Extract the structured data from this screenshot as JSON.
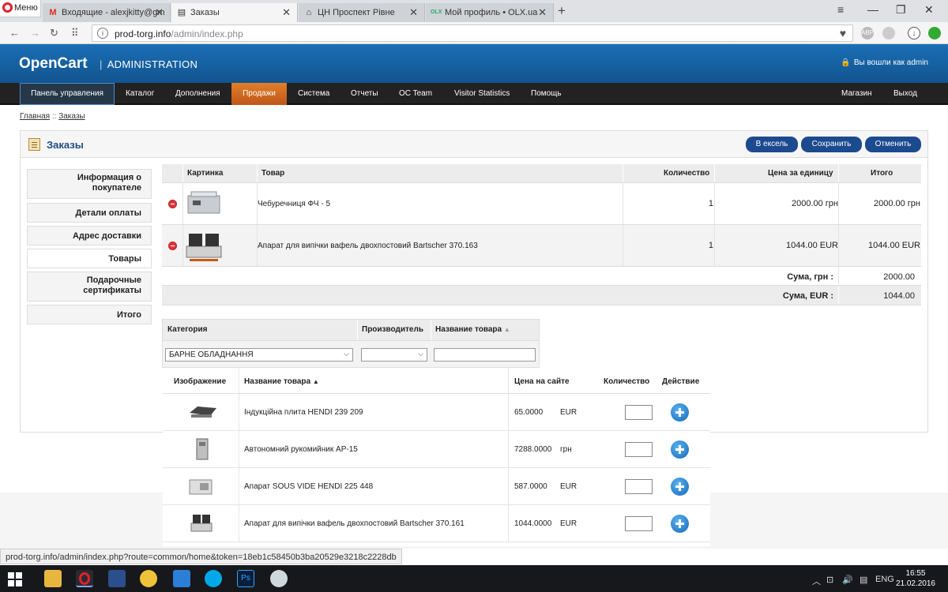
{
  "browser": {
    "menu_label": "Меню",
    "tabs": [
      {
        "icon": "M",
        "title": "Входящие - alexjkitty@gm"
      },
      {
        "icon": "▤",
        "title": "Заказы"
      },
      {
        "icon": "⌂",
        "title": "ЦН Проспект Рівне"
      },
      {
        "icon": "OLX",
        "title": "Мой профиль • OLX.ua"
      }
    ],
    "url_domain": "prod-torg.info",
    "url_path": "/admin/index.php",
    "status_url": "prod-torg.info/admin/index.php?route=common/home&token=18eb1c58450b3ba20529e3218c2228db"
  },
  "header": {
    "logo": "OpenCart",
    "subtitle": "ADMINISTRATION",
    "logged_in": "Вы вошли как admin"
  },
  "menu": {
    "items": [
      "Панель управления",
      "Каталог",
      "Дополнения",
      "Продажи",
      "Система",
      "Отчеты",
      "OC Team",
      "Visitor Statistics",
      "Помощь"
    ],
    "right": [
      "Магазин",
      "Выход"
    ]
  },
  "breadcrumb": {
    "home": "Главная",
    "sep": " :: ",
    "current": "Заказы"
  },
  "page": {
    "title": "Заказы",
    "buttons": {
      "excel": "В ексель",
      "save": "Сохранить",
      "cancel": "Отменить"
    }
  },
  "vtabs": [
    "Информация о покупателе",
    "Детали оплаты",
    "Адрес доставки",
    "Товары",
    "Подарочные сертификаты",
    "Итого"
  ],
  "order_products": {
    "headers": {
      "image": "Картинка",
      "product": "Товар",
      "quantity": "Количество",
      "unit_price": "Цена за единицу",
      "total": "Итого"
    },
    "rows": [
      {
        "name": "Чебуречниця ФЧ - 5",
        "quantity": "1",
        "unit_price": "2000.00 грн",
        "total": "2000.00 грн"
      },
      {
        "name": "Апарат для випічки вафель двохпостовий Bartscher 370.163",
        "quantity": "1",
        "unit_price": "1044.00 EUR",
        "total": "1044.00 EUR"
      }
    ],
    "totals": [
      {
        "label": "Сума, грн :",
        "value": "2000.00"
      },
      {
        "label": "Сума, EUR :",
        "value": "1044.00"
      }
    ]
  },
  "filters": {
    "headers": {
      "category": "Категория",
      "manufacturer": "Производитель",
      "name": "Название товара"
    },
    "category_value": "БАРНЕ ОБЛАДНАННЯ",
    "manufacturer_value": "",
    "name_value": ""
  },
  "picker": {
    "headers": {
      "image": "Изображение",
      "name": "Название товара",
      "price": "Цена на сайте",
      "qty": "Количество",
      "action": "Действие"
    },
    "rows": [
      {
        "name": "Індукційна плита HENDI 239 209",
        "price": "65.0000",
        "currency": "EUR"
      },
      {
        "name": "Автономний рукомийник АР-15",
        "price": "7288.0000",
        "currency": "грн"
      },
      {
        "name": "Апарат SOUS VIDE HENDI 225 448",
        "price": "587.0000",
        "currency": "EUR"
      },
      {
        "name": "Апарат для випічки вафель двохпостовий Bartscher 370.161",
        "price": "1044.0000",
        "currency": "EUR"
      }
    ]
  },
  "taskbar": {
    "lang": "ENG",
    "time": "16:55",
    "date": "21.02.2016"
  }
}
